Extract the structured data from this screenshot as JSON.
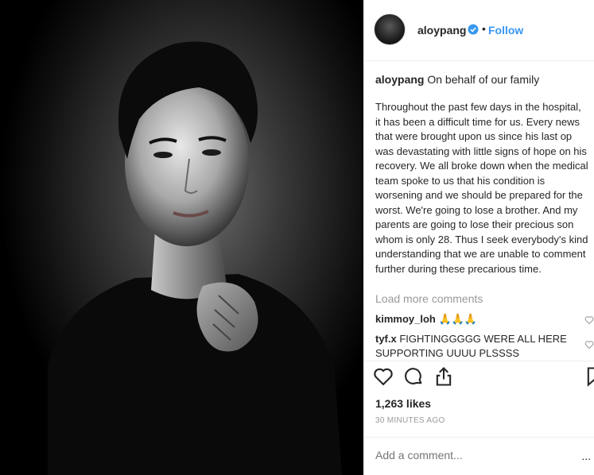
{
  "post": {
    "username": "aloypang",
    "follow_label": "Follow",
    "separator": "•",
    "caption_intro": "On behalf of our family",
    "caption_body": "Throughout the past few days in the hospital, it has been a difficult time for us. Every news that were brought upon us since his last op was devastating with little signs of hope on his recovery. We all broke down when the medical team spoke to us that his condition is worsening and we should be prepared for the worst. We're going to lose a brother. And my parents are going to lose their precious son whom is only 28. Thus I seek everybody's kind understanding that we are unable to comment further during these precarious time.",
    "load_more": "Load more comments",
    "likes": "1,263 likes",
    "time": "30 MINUTES AGO",
    "add_comment_placeholder": "Add a comment...",
    "more": "..."
  },
  "comments": [
    {
      "user": "kimmoy_loh",
      "text": "🙏🙏🙏"
    },
    {
      "user": "tyf.x",
      "text": "FIGHTINGGGGG WERE ALL HERE SUPPORTING UUUU PLSSSS"
    }
  ],
  "icons": {
    "verified": "verified-badge-icon",
    "like": "heart-icon",
    "comment": "comment-icon",
    "share": "share-icon",
    "save": "bookmark-icon"
  },
  "colors": {
    "accent": "#3897f0",
    "text": "#262626",
    "muted": "#999999"
  }
}
